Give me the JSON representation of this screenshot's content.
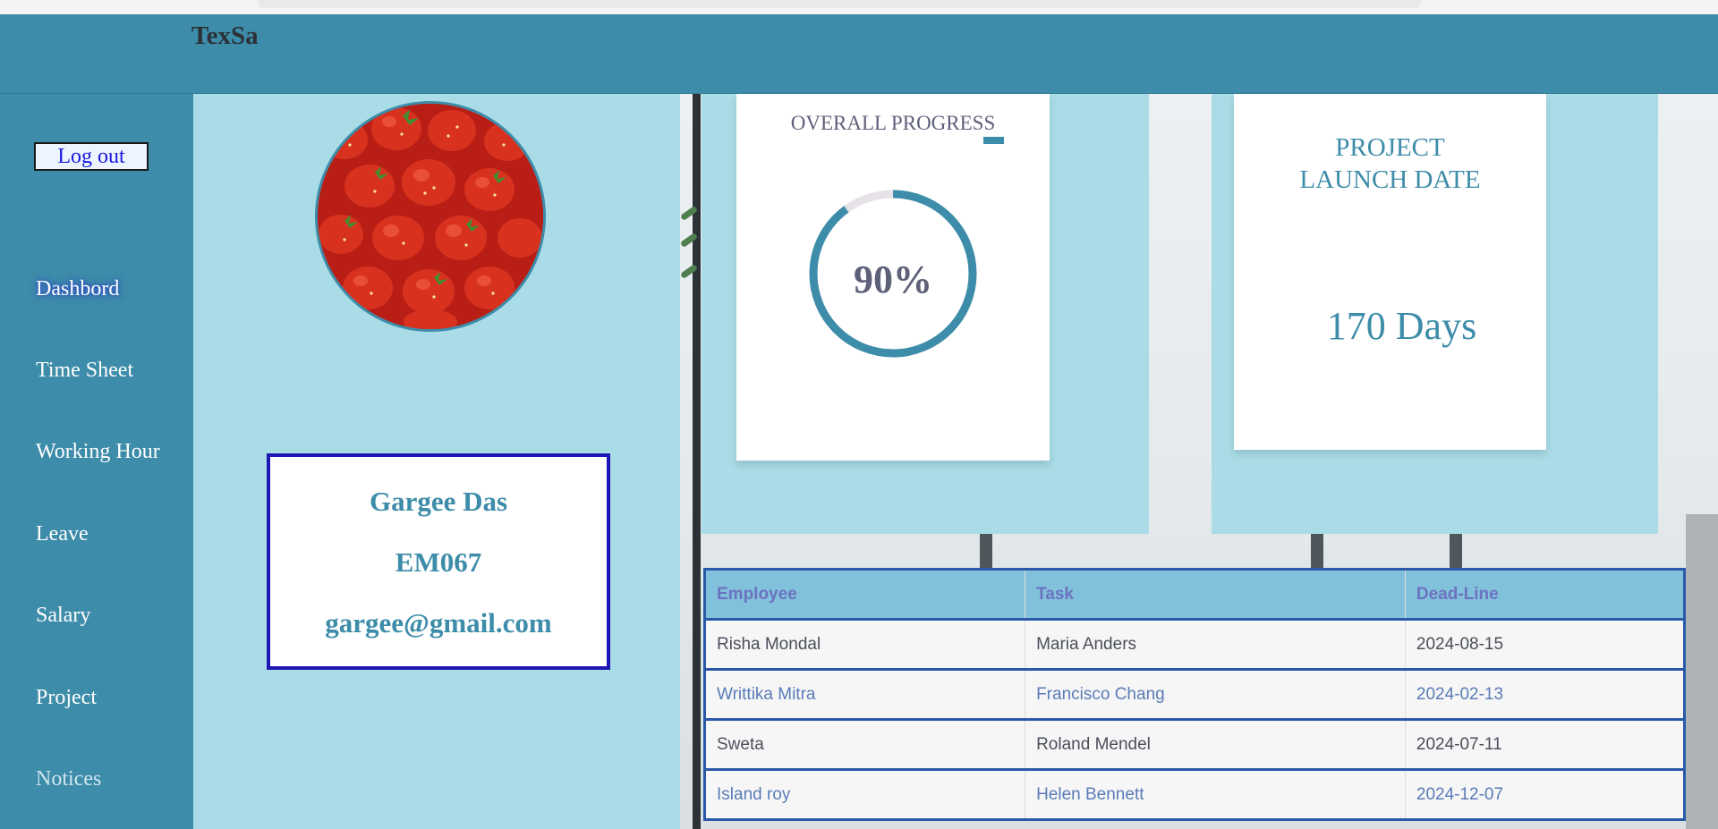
{
  "app": {
    "brand": "TexSa"
  },
  "sidebar": {
    "logout_label": "Log out",
    "items": [
      {
        "label": "Dashbord",
        "active": true
      },
      {
        "label": "Time Sheet"
      },
      {
        "label": "Working Hour"
      },
      {
        "label": "Leave"
      },
      {
        "label": "Salary"
      },
      {
        "label": "Project"
      },
      {
        "label": "Notices"
      }
    ]
  },
  "profile": {
    "avatar_icon": "strawberries-photo",
    "name": "Gargee Das",
    "employee_id": "EM067",
    "email": "gargee@gmail.com"
  },
  "progress": {
    "title": "OVERALL PROGRESS",
    "value_label": "90%",
    "fraction": 0.9
  },
  "launch": {
    "title_line1": "PROJECT",
    "title_line2": "LAUNCH DATE",
    "value": "170 Days"
  },
  "tasks": {
    "headers": [
      "Employee",
      "Task",
      "Dead-Line"
    ],
    "rows": [
      [
        "Risha Mondal",
        "Maria Anders",
        "2024-08-15"
      ],
      [
        "Writtika Mitra",
        "Francisco Chang",
        "2024-02-13"
      ],
      [
        "Sweta",
        "Roland Mendel",
        "2024-07-11"
      ],
      [
        "Island roy",
        "Helen Bennett",
        "2024-12-07"
      ]
    ]
  },
  "colors": {
    "primary": "#3d8ca9",
    "panel": "#a9dce6",
    "card_border": "#1f17b4",
    "table_border": "#2959a8",
    "ring_track": "#e6e2e8"
  }
}
